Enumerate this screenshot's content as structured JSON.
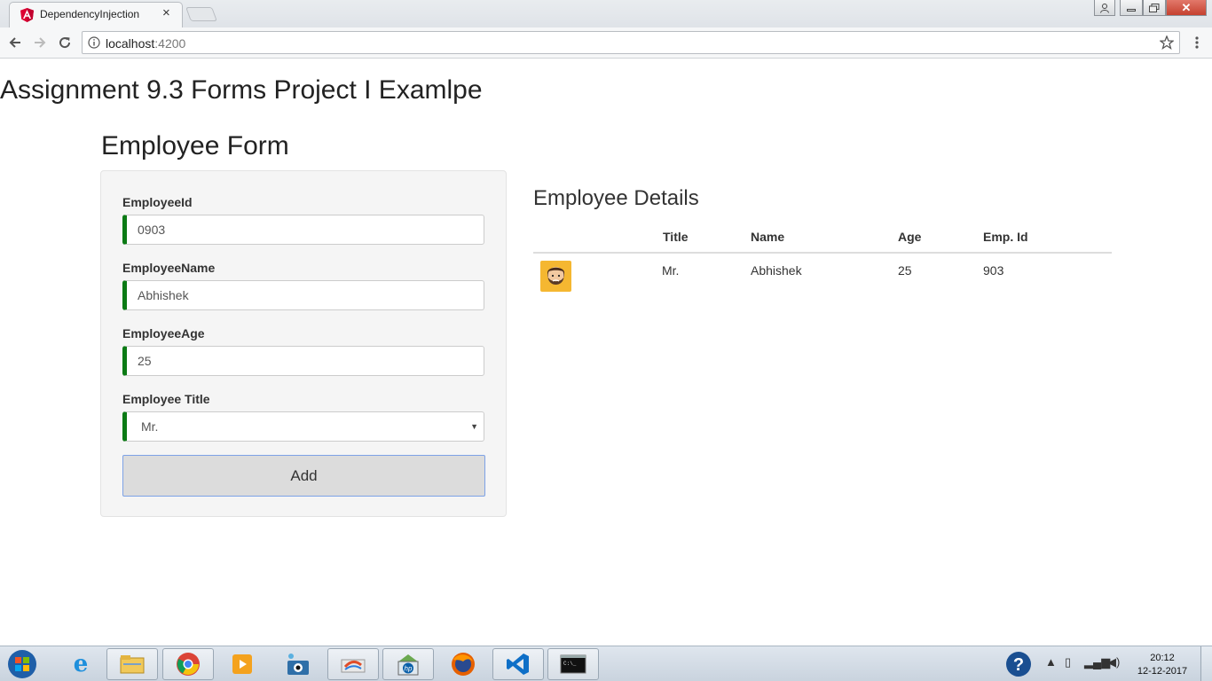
{
  "browser": {
    "tab_title": "DependencyInjection",
    "url_host": "localhost",
    "url_port": ":4200"
  },
  "page": {
    "heading": "Assignment 9.3 Forms Project I Examlpe"
  },
  "form": {
    "title": "Employee Form",
    "fields": [
      {
        "label": "EmployeeId",
        "value": "0903"
      },
      {
        "label": "EmployeeName",
        "value": "Abhishek"
      },
      {
        "label": "EmployeeAge",
        "value": "25"
      }
    ],
    "title_field": {
      "label": "Employee Title",
      "selected": "Mr."
    },
    "add_label": "Add",
    "accent_color": "#0b7a14"
  },
  "details": {
    "title": "Employee Details",
    "columns": [
      "Title",
      "Name",
      "Age",
      "Emp. Id"
    ],
    "rows": [
      {
        "avatar": "bearded-man-avatar",
        "title": "Mr.",
        "name": "Abhishek",
        "age": "25",
        "emp_id": "903"
      }
    ]
  },
  "taskbar": {
    "time": "20:12",
    "date": "12-12-2017",
    "apps": [
      "internet-explorer-icon",
      "file-explorer-icon",
      "chrome-icon",
      "media-player-icon",
      "network-camera-icon",
      "paint-icon",
      "hp-icon",
      "firefox-icon",
      "visual-studio-code-icon",
      "command-prompt-icon"
    ]
  }
}
